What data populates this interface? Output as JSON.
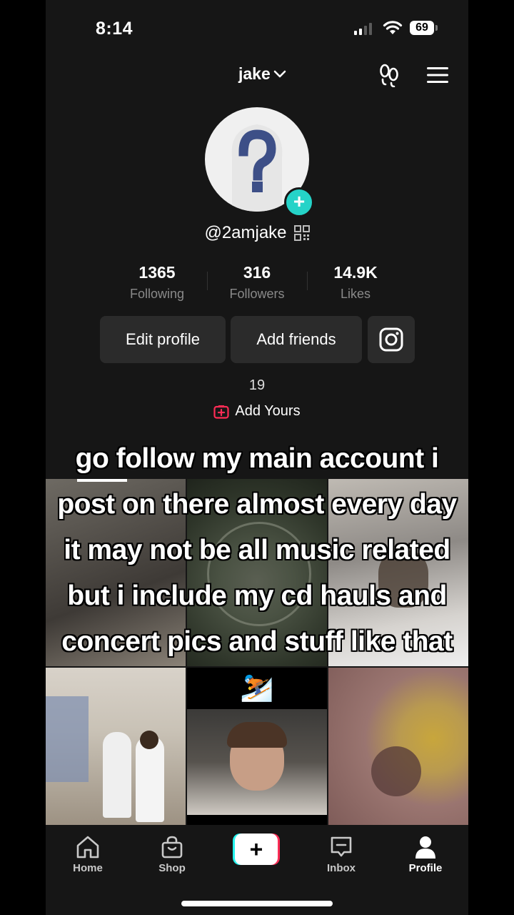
{
  "status": {
    "time": "8:14",
    "battery": "69"
  },
  "header": {
    "username": "jake",
    "icons": [
      "footprints-icon",
      "menu-icon"
    ]
  },
  "profile": {
    "handle": "@2amjake",
    "avatar_icon": "question-mark-placeholder",
    "stats": [
      {
        "value": "1365",
        "label": "Following"
      },
      {
        "value": "316",
        "label": "Followers"
      },
      {
        "value": "14.9K",
        "label": "Likes"
      }
    ],
    "buttons": {
      "edit": "Edit profile",
      "add_friends": "Add friends",
      "instagram_icon": "instagram-icon"
    },
    "add_yours": {
      "count": "19",
      "label": "Add Yours"
    }
  },
  "overlay_caption": [
    "go follow my main account i",
    "post on there almost every day",
    "it may not be all music related",
    "but i include my cd hauls and",
    "concert pics and stuff like that"
  ],
  "grid": {
    "emoji": "⛷️"
  },
  "tabs": [
    {
      "label": "Home",
      "icon": "home-icon"
    },
    {
      "label": "Shop",
      "icon": "shop-bag-icon"
    },
    {
      "label": "",
      "icon": "create-plus-icon"
    },
    {
      "label": "Inbox",
      "icon": "inbox-icon"
    },
    {
      "label": "Profile",
      "icon": "profile-icon"
    }
  ],
  "colors": {
    "accent_teal": "#25f4ee",
    "accent_red": "#fe2c55",
    "badge": "#25d3c8",
    "bg": "#161616"
  }
}
